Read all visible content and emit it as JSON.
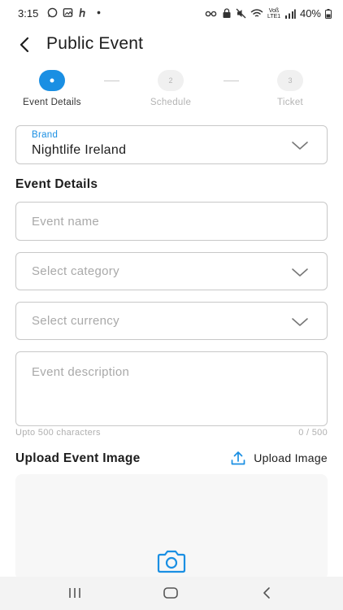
{
  "status_bar": {
    "time": "3:15",
    "network_label": "Voß LTE1",
    "battery": "40%"
  },
  "header": {
    "title": "Public Event"
  },
  "stepper": {
    "steps": [
      {
        "number": "1",
        "label": "Event Details",
        "active": true
      },
      {
        "number": "2",
        "label": "Schedule",
        "active": false
      },
      {
        "number": "3",
        "label": "Ticket",
        "active": false
      }
    ]
  },
  "form": {
    "brand": {
      "label": "Brand",
      "value": "Nightlife Ireland"
    },
    "section_title": "Event Details",
    "event_name_placeholder": "Event name",
    "category_placeholder": "Select category",
    "currency_placeholder": "Select currency",
    "description_placeholder": "Event description",
    "description_helper": "Upto 500 characters",
    "description_counter": "0 / 500"
  },
  "upload": {
    "title": "Upload Event Image",
    "button_label": "Upload Image"
  },
  "colors": {
    "accent": "#1a8fe3",
    "border": "#c8c8c8",
    "placeholder": "#a9a9a9"
  },
  "icons": {
    "back": "back-arrow-icon",
    "dropdown": "chevron-down-icon",
    "upload": "upload-icon",
    "camera": "camera-icon"
  }
}
